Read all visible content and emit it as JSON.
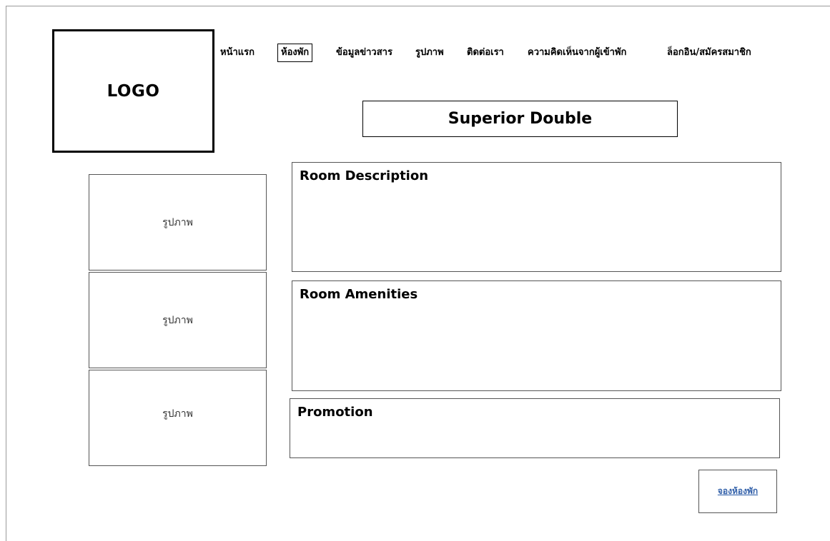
{
  "logo": {
    "text": "LOGO"
  },
  "nav": {
    "items": [
      {
        "label": "หน้าแรก",
        "active": false
      },
      {
        "label": "ห้องพัก",
        "active": true
      },
      {
        "label": "ข้อมูลข่าวสาร",
        "active": false
      },
      {
        "label": "รูปภาพ",
        "active": false
      },
      {
        "label": "ติดต่อเรา",
        "active": false
      },
      {
        "label": "ความคิดเห็นจากผู้เข้าพัก",
        "active": false
      },
      {
        "label": "ล็อกอิน/สมัครสมาชิก",
        "active": false
      }
    ]
  },
  "room": {
    "title": "Superior Double"
  },
  "gallery": {
    "images": [
      {
        "label": "รูปภาพ"
      },
      {
        "label": "รูปภาพ"
      },
      {
        "label": "รูปภาพ"
      }
    ]
  },
  "sections": {
    "description": {
      "title": "Room Description"
    },
    "amenities": {
      "title": "Room Amenities"
    },
    "promotion": {
      "title": "Promotion"
    }
  },
  "booking": {
    "label": "จองห้องพัก"
  },
  "colors": {
    "border": "#000000",
    "panel_border": "#555555",
    "link": "#2f5ea8"
  }
}
